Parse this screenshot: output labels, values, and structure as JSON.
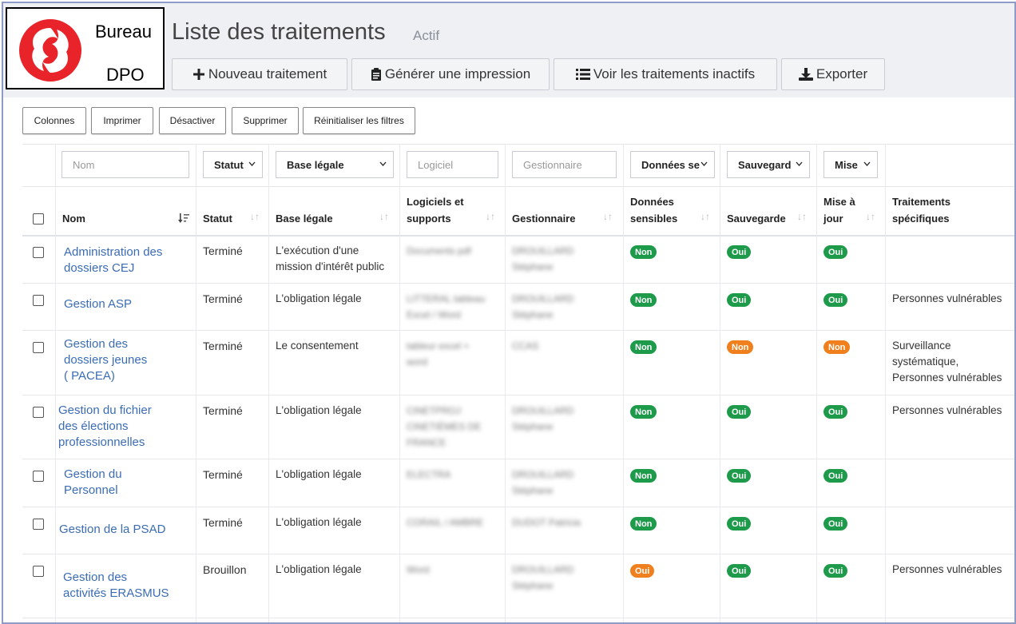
{
  "logo": {
    "line1": "Bureau",
    "line2": "DPO",
    "color": "#e8232a"
  },
  "header": {
    "title": "Liste des traitements",
    "subtitle": "Actif"
  },
  "toolbar": [
    {
      "label": "Nouveau traitement",
      "icon": "plus-icon"
    },
    {
      "label": "Générer une impression",
      "icon": "clipboard-icon"
    },
    {
      "label": "Voir les traitements inactifs",
      "icon": "list-icon"
    },
    {
      "label": "Exporter",
      "icon": "download-icon"
    }
  ],
  "secondary_toolbar": [
    "Colonnes",
    "Imprimer",
    "Désactiver",
    "Supprimer",
    "Réinitialiser les filtres"
  ],
  "filters": {
    "nom_placeholder": "Nom",
    "statut": "Statut",
    "base_legale": "Base légale",
    "logiciel_placeholder": "Logiciel",
    "gestionnaire_placeholder": "Gestionnaire",
    "donnees": "Données se",
    "sauvegarde": "Sauvegarde",
    "mise": "Mise à"
  },
  "columns": {
    "nom": "Nom",
    "statut": "Statut",
    "base_legale": "Base légale",
    "logiciels_1": "Logiciels et",
    "logiciels_2": "supports",
    "gestionnaire": "Gestionnaire",
    "donnees_1": "Données",
    "donnees_2": "sensibles",
    "sauvegarde": "Sauvegarde",
    "mise_1": "Mise à",
    "mise_2": "jour",
    "traitements_1": "Traitements",
    "traitements_2": "spécifiques"
  },
  "rows": [
    {
      "name": [
        "Administration des",
        "dossiers CEJ"
      ],
      "statut": "Terminé",
      "base": [
        "L'exécution d'une",
        "mission d'intérêt public"
      ],
      "logiciels": [
        "Documents pdf"
      ],
      "gestionnaire": [
        "DROUILLARD",
        "Stéphane"
      ],
      "donnees": "Non",
      "sauvegarde": "Oui",
      "mise": "Oui",
      "specifiques": []
    },
    {
      "name": [
        "Gestion ASP"
      ],
      "statut": "Terminé",
      "base": [
        "L'obligation légale"
      ],
      "logiciels": [
        "LITTERAL tableau",
        "Excel / Word"
      ],
      "gestionnaire": [
        "DROUILLARD",
        "Stéphane"
      ],
      "donnees": "Non",
      "sauvegarde": "Oui",
      "mise": "Oui",
      "specifiques": [
        "Personnes vulnérables"
      ]
    },
    {
      "name": [
        "Gestion des",
        "dossiers jeunes",
        "( PACEA)"
      ],
      "statut": "Terminé",
      "base": [
        "Le consentement"
      ],
      "logiciels": [
        "tableur excel +",
        "word"
      ],
      "gestionnaire": [
        "CCAS"
      ],
      "donnees": "Non",
      "sauvegarde": "Non",
      "mise": "Non",
      "specifiques": [
        "Surveillance",
        "systématique,",
        "Personnes vulnérables"
      ]
    },
    {
      "name": [
        "Gestion du fichier",
        "des élections",
        "professionnelles"
      ],
      "statut": "Terminé",
      "base": [
        "L'obligation légale"
      ],
      "logiciels": [
        "CINETPROJ",
        "CINETIÈMES DE",
        "FRANCE"
      ],
      "gestionnaire": [
        "DROUILLARD",
        "Stéphane"
      ],
      "donnees": "Non",
      "sauvegarde": "Oui",
      "mise": "Oui",
      "specifiques": [
        "Personnes vulnérables"
      ]
    },
    {
      "name": [
        "Gestion du",
        "Personnel"
      ],
      "statut": "Terminé",
      "base": [
        "L'obligation légale"
      ],
      "logiciels": [
        "ELECTRA"
      ],
      "gestionnaire": [
        "DROUILLARD",
        "Stéphane"
      ],
      "donnees": "Non",
      "sauvegarde": "Oui",
      "mise": "Oui",
      "specifiques": []
    },
    {
      "name": [
        "Gestion de la PSAD"
      ],
      "statut": "Terminé",
      "base": [
        "L'obligation légale"
      ],
      "logiciels": [
        "CORAIL / AMBRE"
      ],
      "gestionnaire": [
        "DUDOT Patricia"
      ],
      "donnees": "Non",
      "sauvegarde": "Oui",
      "mise": "Oui",
      "specifiques": []
    },
    {
      "name": [
        "Gestion des",
        "activités ERASMUS"
      ],
      "statut": "Brouillon",
      "base": [
        "L'obligation légale"
      ],
      "logiciels": [
        "Word"
      ],
      "gestionnaire": [
        "DROUILLARD",
        "Stéphane"
      ],
      "donnees": "Oui",
      "sauvegarde": "Oui",
      "mise": "Oui",
      "specifiques": [
        "Personnes vulnérables"
      ]
    }
  ],
  "colors": {
    "accent": "#3b6cb4",
    "green": "#1e9a4b",
    "orange": "#f07f1d",
    "frame": "#8e9bc7"
  }
}
